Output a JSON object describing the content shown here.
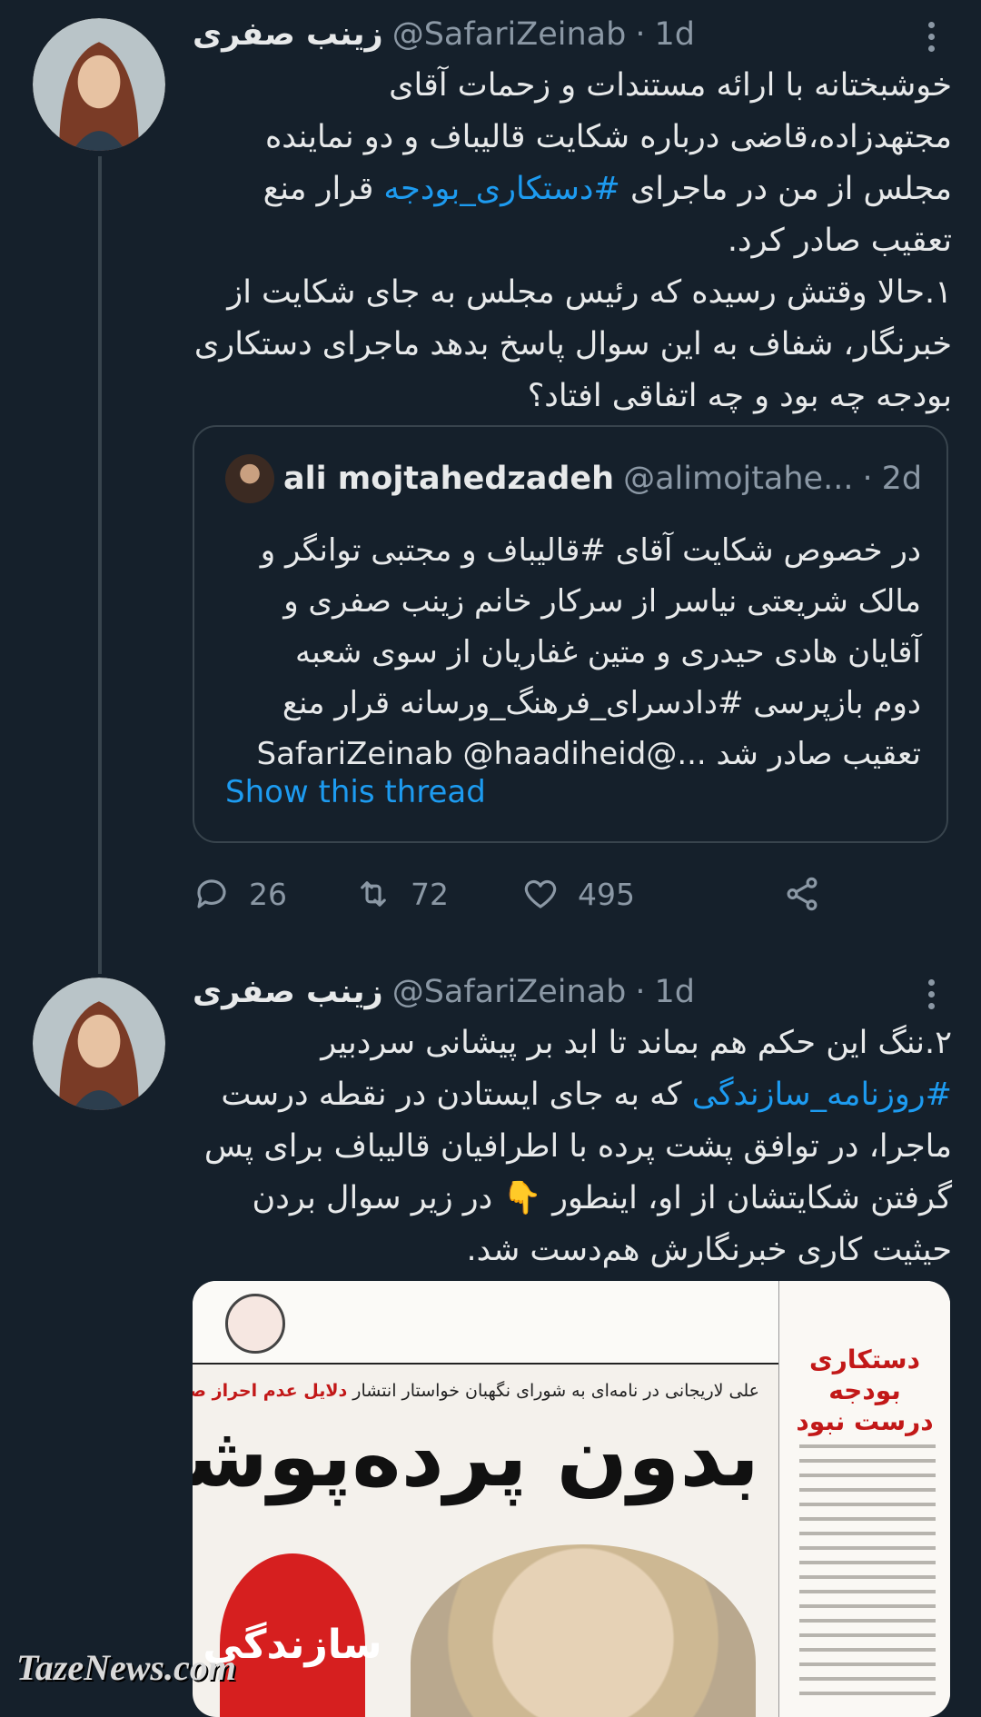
{
  "tweets": [
    {
      "display_name": "زینب صفری",
      "handle": "@SafariZeinab",
      "separator": "·",
      "time": "1d",
      "text_parts": [
        {
          "t": "خوشبختانه با ارائه مستندات و زحمات آقای\nمجتهدزاده،قاضی درباره شکایت قالیباف و دو نماینده\nمجلس از من در ماجرای ",
          "tag": false
        },
        {
          "t": "#دستکاری_بودجه",
          "tag": true
        },
        {
          "t": " قرار منع\nتعقیب صادر کرد.\n۱.حالا وقتش رسیده که رئیس مجلس به جای شکایت از\nخبرنگار، شفاف به این سوال پاسخ بدهد ماجرای دستکاری\nبودجه چه بود و چه اتفاقی افتاد؟",
          "tag": false
        }
      ],
      "quote": {
        "display_name": "ali mojtahedzadeh",
        "handle": "@alimojtahe...",
        "separator": "·",
        "time": "2d",
        "text": "در خصوص شکایت آقای #قالیباف و مجتبی توانگر و\nمالک شریعتی نیاسر از سرکار خانم زینب صفری و\nآقایان هادی حیدری و متین غفاریان از سوی شعبه\nدوم بازپرسی #دادسرای_فرهنگ_ورسانه قرار منع\nتعقیب صادر شد ...@SafariZeinab @haadiheid",
        "show_thread": "Show this thread"
      },
      "actions": {
        "replies": "26",
        "retweets": "72",
        "likes": "495"
      }
    },
    {
      "display_name": "زینب صفری",
      "handle": "@SafariZeinab",
      "separator": "·",
      "time": "1d",
      "text_parts": [
        {
          "t": "۲.ننگ این حکم هم بماند تا ابد بر پیشانی سردبیر\n",
          "tag": false
        },
        {
          "t": "#روزنامه_سازندگی",
          "tag": true
        },
        {
          "t": " که به جای ایستادن در نقطه درست\nماجرا، در توافق پشت پرده با اطرافیان قالیباف برای پس\nگرفتن شکایتشان از او، اینطور 👇 در زیر سوال بردن\nحیثیت کاری خبرنگارش هم‌دست شد.",
          "tag": false
        }
      ],
      "newspaper": {
        "side_title": "دستکاری بودجه درست نبود",
        "sub_prefix": "علی لاریجانی در نامه‌ای به شورای نگهبان خواستار انتشار",
        "sub_highlight": "دلایل عدم احراز صلاحیتش شد",
        "headline": "بدون پرده‌پوشی",
        "logo": "سازندگی"
      }
    }
  ],
  "watermark": "TazeNews.com",
  "colors": {
    "background": "#15202b",
    "accent": "#1d9bf0",
    "muted": "#8b98a5",
    "divider": "#38444d"
  }
}
